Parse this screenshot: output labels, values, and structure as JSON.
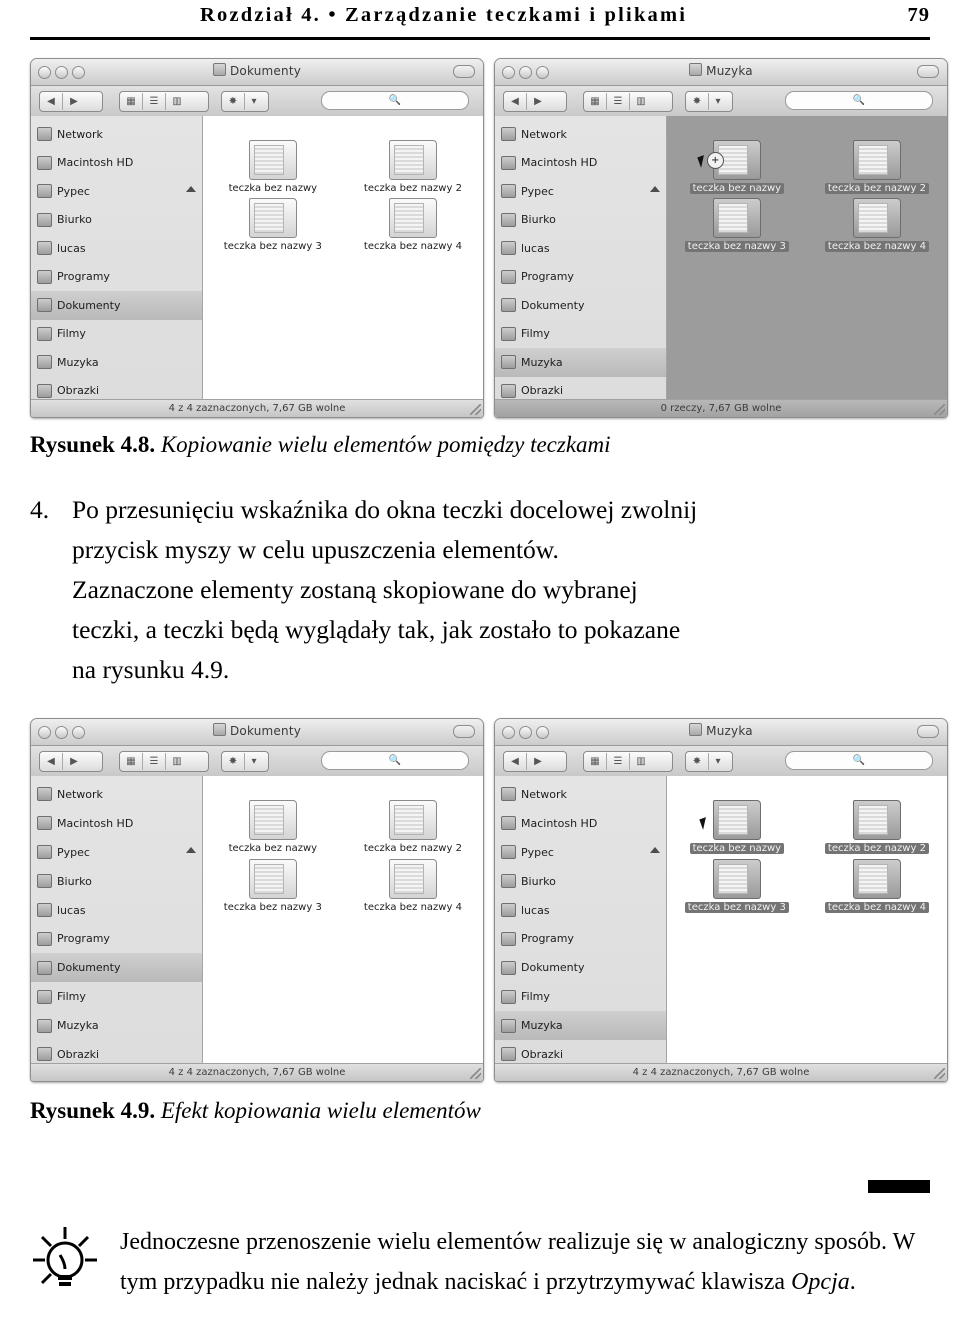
{
  "header": {
    "title": "Rozdział 4. • Zarządzanie teczkami i plikami",
    "page_number": "79"
  },
  "figures": [
    {
      "id": "figure-4-8",
      "caption_label": "Rysunek 4.8.",
      "caption_text": "Kopiowanie wielu elementów pomiędzy teczkami",
      "windows": [
        {
          "title": "Dokumenty",
          "search_placeholder": "",
          "sidebar": [
            {
              "label": "Network",
              "selected": false,
              "eject": false
            },
            {
              "label": "Macintosh HD",
              "selected": false,
              "eject": false
            },
            {
              "label": "Pypec",
              "selected": false,
              "eject": true
            },
            {
              "label": "Biurko",
              "selected": false,
              "eject": false
            },
            {
              "label": "lucas",
              "selected": false,
              "eject": false
            },
            {
              "label": "Programy",
              "selected": false,
              "eject": false
            },
            {
              "label": "Dokumenty",
              "selected": true,
              "eject": false
            },
            {
              "label": "Filmy",
              "selected": false,
              "eject": false
            },
            {
              "label": "Muzyka",
              "selected": false,
              "eject": false
            },
            {
              "label": "Obrazki",
              "selected": false,
              "eject": false
            }
          ],
          "items": [
            {
              "label": "teczka bez nazwy",
              "selected": false
            },
            {
              "label": "teczka bez nazwy 2",
              "selected": false
            },
            {
              "label": "teczka bez nazwy 3",
              "selected": false
            },
            {
              "label": "teczka bez nazwy 4",
              "selected": false
            }
          ],
          "status": "4 z 4 zaznaczonych, 7,67 GB wolne",
          "dimmed": false
        },
        {
          "title": "Muzyka",
          "search_placeholder": "",
          "sidebar": [
            {
              "label": "Network",
              "selected": false,
              "eject": false
            },
            {
              "label": "Macintosh HD",
              "selected": false,
              "eject": false
            },
            {
              "label": "Pypec",
              "selected": false,
              "eject": true
            },
            {
              "label": "Biurko",
              "selected": false,
              "eject": false
            },
            {
              "label": "lucas",
              "selected": false,
              "eject": false
            },
            {
              "label": "Programy",
              "selected": false,
              "eject": false
            },
            {
              "label": "Dokumenty",
              "selected": false,
              "eject": false
            },
            {
              "label": "Filmy",
              "selected": false,
              "eject": false
            },
            {
              "label": "Muzyka",
              "selected": true,
              "eject": false
            },
            {
              "label": "Obrazki",
              "selected": false,
              "eject": false
            }
          ],
          "items": [
            {
              "label": "teczka bez nazwy",
              "selected": true
            },
            {
              "label": "teczka bez nazwy 2",
              "selected": true
            },
            {
              "label": "teczka bez nazwy 3",
              "selected": true
            },
            {
              "label": "teczka bez nazwy 4",
              "selected": true
            }
          ],
          "status": "0 rzeczy, 7,67 GB wolne",
          "dimmed": true,
          "drag_badge": "+"
        }
      ]
    },
    {
      "id": "figure-4-9",
      "caption_label": "Rysunek 4.9.",
      "caption_text": "Efekt kopiowania wielu elementów",
      "windows": [
        {
          "title": "Dokumenty",
          "search_placeholder": "",
          "sidebar": [
            {
              "label": "Network",
              "selected": false,
              "eject": false
            },
            {
              "label": "Macintosh HD",
              "selected": false,
              "eject": false
            },
            {
              "label": "Pypec",
              "selected": false,
              "eject": true
            },
            {
              "label": "Biurko",
              "selected": false,
              "eject": false
            },
            {
              "label": "lucas",
              "selected": false,
              "eject": false
            },
            {
              "label": "Programy",
              "selected": false,
              "eject": false
            },
            {
              "label": "Dokumenty",
              "selected": true,
              "eject": false
            },
            {
              "label": "Filmy",
              "selected": false,
              "eject": false
            },
            {
              "label": "Muzyka",
              "selected": false,
              "eject": false
            },
            {
              "label": "Obrazki",
              "selected": false,
              "eject": false
            }
          ],
          "items": [
            {
              "label": "teczka bez nazwy",
              "selected": false
            },
            {
              "label": "teczka bez nazwy 2",
              "selected": false
            },
            {
              "label": "teczka bez nazwy 3",
              "selected": false
            },
            {
              "label": "teczka bez nazwy 4",
              "selected": false
            }
          ],
          "status": "4 z 4 zaznaczonych, 7,67 GB wolne",
          "dimmed": false
        },
        {
          "title": "Muzyka",
          "search_placeholder": "",
          "sidebar": [
            {
              "label": "Network",
              "selected": false,
              "eject": false
            },
            {
              "label": "Macintosh HD",
              "selected": false,
              "eject": false
            },
            {
              "label": "Pypec",
              "selected": false,
              "eject": true
            },
            {
              "label": "Biurko",
              "selected": false,
              "eject": false
            },
            {
              "label": "lucas",
              "selected": false,
              "eject": false
            },
            {
              "label": "Programy",
              "selected": false,
              "eject": false
            },
            {
              "label": "Dokumenty",
              "selected": false,
              "eject": false
            },
            {
              "label": "Filmy",
              "selected": false,
              "eject": false
            },
            {
              "label": "Muzyka",
              "selected": true,
              "eject": false
            },
            {
              "label": "Obrazki",
              "selected": false,
              "eject": false
            }
          ],
          "items": [
            {
              "label": "teczka bez nazwy",
              "selected": true
            },
            {
              "label": "teczka bez nazwy 2",
              "selected": true
            },
            {
              "label": "teczka bez nazwy 3",
              "selected": true
            },
            {
              "label": "teczka bez nazwy 4",
              "selected": true
            }
          ],
          "status": "4 z 4 zaznaczonych, 7,67 GB wolne",
          "dimmed": false
        }
      ]
    }
  ],
  "body": {
    "step_number": "4.",
    "step_lines": [
      "Po przesunięciu wskaźnika do okna teczki docelowej zwolnij",
      "przycisk myszy w celu upuszczenia elementów.",
      "Zaznaczone elementy zostaną skopiowane do wybranej",
      "teczki, a teczki będą wyglądały tak, jak zostało to pokazane",
      "na rysunku 4.9."
    ]
  },
  "tip": {
    "icon_name": "tip-lightbulb-icon",
    "lines": [
      "Jednoczesne przenoszenie wielu elementów realizuje się w analogiczny",
      "sposób. W tym przypadku nie należy jednak naciskać i przytrzymywać",
      "klawisza "
    ],
    "emphasis": "Opcja",
    "trailing": "."
  }
}
